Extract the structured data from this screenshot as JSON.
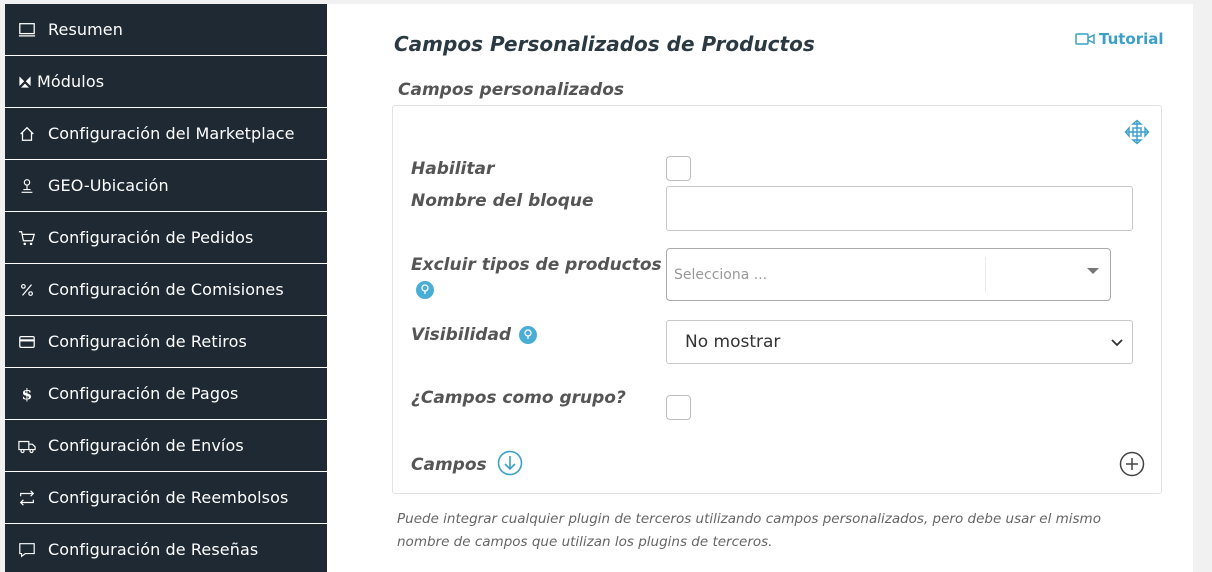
{
  "sidebar": {
    "items": [
      {
        "label": "Resumen",
        "icon": "monitor-icon"
      },
      {
        "label": "Módulos",
        "icon": "modules-icon"
      },
      {
        "label": "Configuración del Marketplace",
        "icon": "home-icon"
      },
      {
        "label": "GEO-Ubicación",
        "icon": "location-pin-icon"
      },
      {
        "label": "Configuración de Pedidos",
        "icon": "cart-icon"
      },
      {
        "label": "Configuración de Comisiones",
        "icon": "percent-icon"
      },
      {
        "label": "Configuración de Retiros",
        "icon": "credit-card-icon"
      },
      {
        "label": "Configuración de Pagos",
        "icon": "dollar-icon"
      },
      {
        "label": "Configuración de Envíos",
        "icon": "truck-icon"
      },
      {
        "label": "Configuración de Reembolsos",
        "icon": "refund-arrows-icon"
      },
      {
        "label": "Configuración de Reseñas",
        "icon": "comment-icon"
      }
    ]
  },
  "main": {
    "title": "Campos Personalizados de Productos",
    "tutorial_label": "Tutorial",
    "section_title": "Campos personalizados",
    "form": {
      "enable_label": "Habilitar",
      "enable_checked": false,
      "block_name_label": "Nombre del bloque",
      "block_name_value": "",
      "exclude_label": "Excluir tipos de productos",
      "exclude_placeholder": "Selecciona  ...",
      "visibility_label": "Visibilidad",
      "visibility_value": "No mostrar",
      "group_label": "¿Campos como grupo?",
      "group_checked": false,
      "fields_label": "Campos"
    },
    "note": "Puede integrar cualquier plugin de terceros utilizando campos personalizados, pero debe usar el mismo nombre de campos que utilizan los plugins de terceros."
  },
  "colors": {
    "sidebar_bg": "#1f2933",
    "accent": "#3aa0c8",
    "text_dark": "#2b3a42",
    "label": "#555555"
  }
}
